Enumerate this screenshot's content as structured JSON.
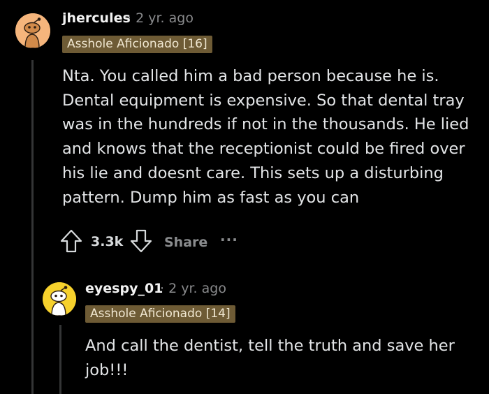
{
  "comments": [
    {
      "username": "jhercules",
      "age": "2 yr. ago",
      "flair": "Asshole Aficionado [16]",
      "body": "Nta. You called him a bad person because he is.\nDental equipment is expensive. So that dental tray\nwas in the hundreds if not in the thousands. He lied\nand knows that the receptionist could be fired over\nhis lie and doesnt care. This sets up a disturbing\npattern. Dump him as fast as you can",
      "votes": "3.3k",
      "share_label": "Share",
      "more_label": "···",
      "avatar_color": "#f5b57c"
    },
    {
      "username": "eyespy_01",
      "age": "2 yr. ago",
      "flair": "Asshole Aficionado [14]",
      "body": "And call the dentist, tell the truth and save her\njob!!!",
      "avatar_color": "#f6d12c"
    }
  ],
  "meta_separator": "·",
  "colors": {
    "background": "#000000",
    "flair_bg": "#6e5b35",
    "muted": "#898a8c"
  }
}
